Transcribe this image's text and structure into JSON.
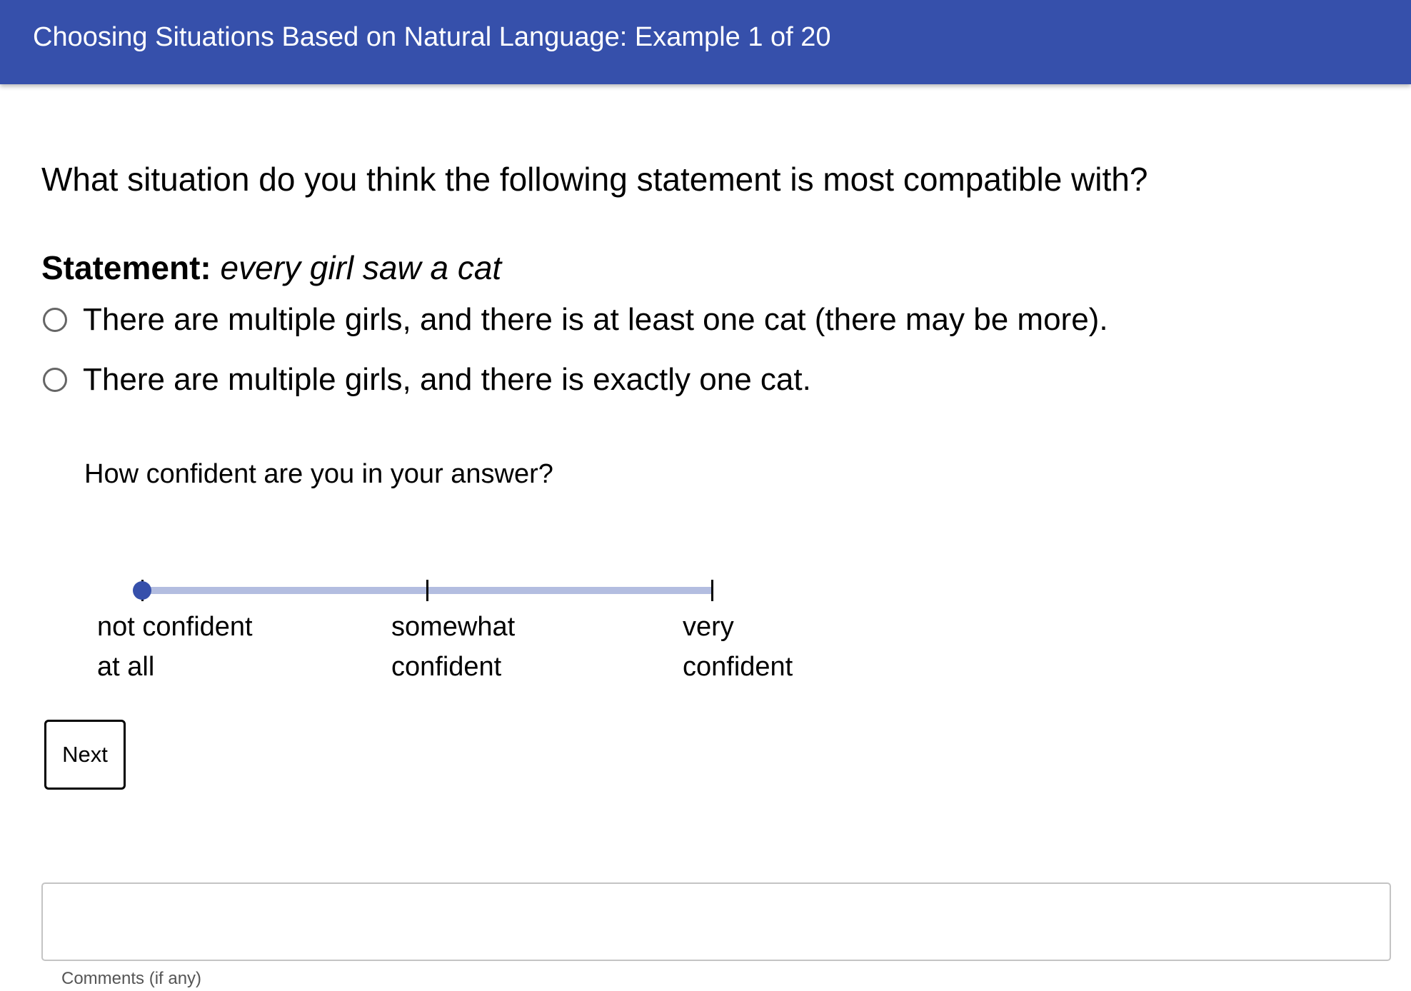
{
  "header": {
    "title": "Choosing Situations Based on Natural Language: Example 1 of 20",
    "background_color": "#3650ab"
  },
  "question": {
    "text": "What situation do you think the following statement is most compatible with?"
  },
  "statement": {
    "label": "Statement:",
    "text": "every girl saw a cat"
  },
  "options": [
    {
      "label": "There are multiple girls, and there is at least one cat (there may be more).",
      "selected": false
    },
    {
      "label": "There are multiple girls, and there is exactly one cat.",
      "selected": false
    }
  ],
  "confidence": {
    "question": "How confident are you in your answer?",
    "value": 0,
    "scale": [
      0,
      1,
      2
    ],
    "ticks": [
      {
        "line1": "not confident",
        "line2": "at all"
      },
      {
        "line1": "somewhat",
        "line2": "confident"
      },
      {
        "line1": "very",
        "line2": "confident"
      }
    ],
    "track_color": "#b3bde0",
    "thumb_color": "#3650ab"
  },
  "next_button": {
    "label": "Next"
  },
  "comments": {
    "value": "",
    "label": "Comments (if any)"
  }
}
